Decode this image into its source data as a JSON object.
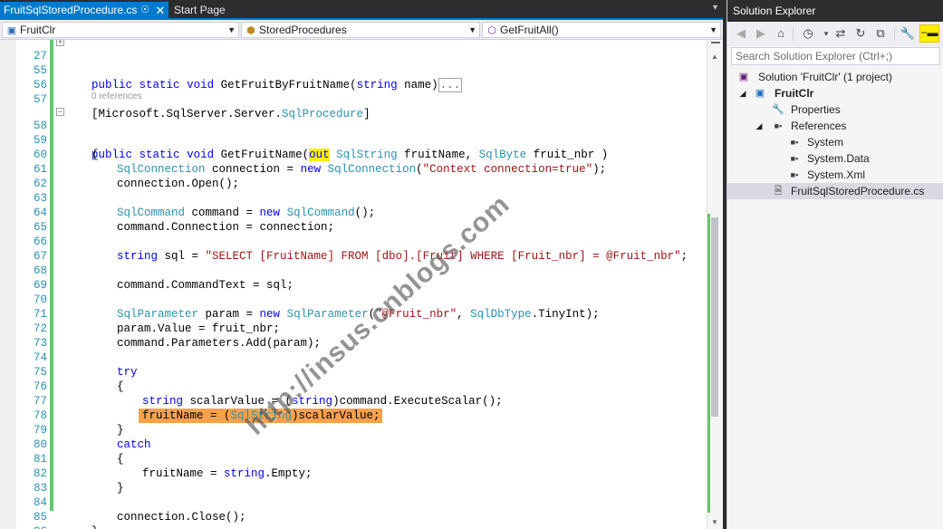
{
  "tabs": {
    "active": "FruitSqlStoredProcedure.cs",
    "inactive": "Start Page"
  },
  "navbar": {
    "project": "FruitClr",
    "type": "StoredProcedures",
    "member": "GetFruitAll()"
  },
  "code": {
    "references_label": "0 references",
    "collapsed_marker": "...",
    "lines": {
      "l27": "27",
      "l55": "55",
      "l56": "56",
      "l57": "57",
      "l58": "58",
      "l59": "59",
      "l60": "60",
      "l61": "61",
      "l62": "62",
      "l63": "63",
      "l64": "64",
      "l65": "65",
      "l66": "66",
      "l67": "67",
      "l68": "68",
      "l69": "69",
      "l70": "70",
      "l71": "71",
      "l72": "72",
      "l73": "73",
      "l74": "74",
      "l75": "75",
      "l76": "76",
      "l77": "77",
      "l78": "78",
      "l79": "79",
      "l80": "80",
      "l81": "81",
      "l82": "82",
      "l83": "83",
      "l84": "84",
      "l85": "85",
      "l86": "86"
    },
    "t": {
      "public": "public",
      "static": "static",
      "void": "void",
      "string": "string",
      "out": "out",
      "new": "new",
      "try": "try",
      "catch": "catch",
      "GetFruitByFruitName": " GetFruitByFruitName(",
      "name_close": " name)",
      "attr_open": "[Microsoft.SqlServer.Server.",
      "SqlProcedure": "SqlProcedure",
      "attr_close": "]",
      "GetFruitName": " GetFruitName(",
      "SqlString": "SqlString",
      "fruitName_param": " fruitName, ",
      "SqlByte": "SqlByte",
      "fruit_nbr_param": " fruit_nbr )",
      "brace_open": "{",
      "brace_close": "}",
      "SqlConnection": "SqlConnection",
      "connection_eq": " connection = ",
      "ctx_str": "\"Context connection=true\"",
      "paren_semi": ");",
      "conn_open": "connection.Open();",
      "SqlCommand": "SqlCommand",
      "command_eq": " command = ",
      "empty_call": "();",
      "cmd_conn": "command.Connection = connection;",
      "sql_eq": " sql = ",
      "sql_str": "\"SELECT [FruitName] FROM [dbo].[Fruit] WHERE [Fruit_nbr] = @Fruit_nbr\"",
      "semi": ";",
      "cmd_text": "command.CommandText = sql;",
      "SqlParameter": "SqlParameter",
      "param_eq": " param = ",
      "param_str": "\"@Fruit_nbr\"",
      "comma": ", ",
      "SqlDbType": "SqlDbType",
      "tinyint": ".TinyInt);",
      "param_value": "param.Value = fruit_nbr;",
      "params_add": "command.Parameters.Add(param);",
      "scalar_decl": " scalarValue = (",
      "scalar_exec": ")command.ExecuteScalar();",
      "fruitName_cast": "fruitName = (",
      "scalar_assign": ")scalarValue;",
      "fruitName_eq": "fruitName = ",
      "string_empty": ".Empty;",
      "conn_close": "connection.Close();",
      "paren_open": "("
    }
  },
  "watermark": "http://insus.cnblogs.com",
  "solution_explorer": {
    "title": "Solution Explorer",
    "search_placeholder": "Search Solution Explorer (Ctrl+;)",
    "solution": "Solution 'FruitClr' (1 project)",
    "project": "FruitClr",
    "properties": "Properties",
    "references": "References",
    "ref_system": "System",
    "ref_system_data": "System.Data",
    "ref_system_xml": "System.Xml",
    "file": "FruitSqlStoredProcedure.cs"
  },
  "icons": {
    "close": "close-icon",
    "pin": "pin-icon",
    "back": "back-icon",
    "forward": "forward-icon",
    "home": "home-icon",
    "history": "history-icon",
    "sync": "sync-icon",
    "refresh": "refresh-icon",
    "collapse": "collapse-all-icon",
    "properties": "wrench-icon"
  },
  "colors": {
    "accent": "#007acc",
    "keyword": "#0000ff",
    "type": "#2b91af",
    "string": "#a31515",
    "highlight_orange": "#f8a14b",
    "highlight_yellow": "#ffef00",
    "change_bar": "#6bc46d"
  }
}
